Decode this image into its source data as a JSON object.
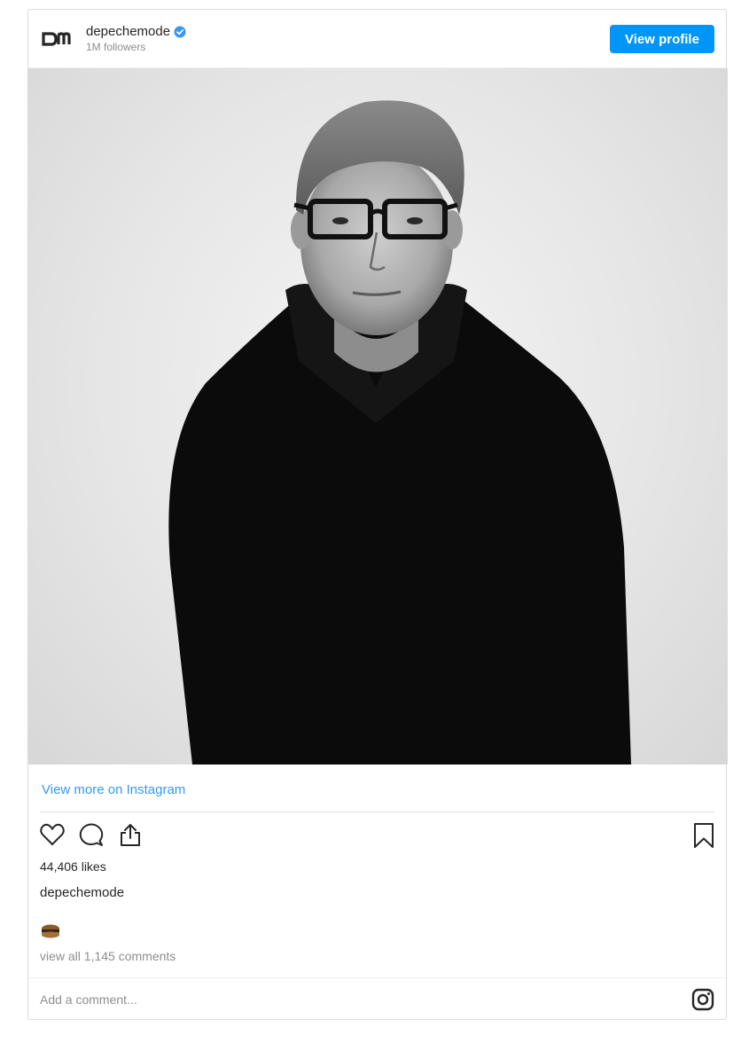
{
  "header": {
    "username": "depechemode",
    "followers": "1M followers",
    "view_profile_label": "View profile"
  },
  "post": {
    "view_more_label": "View more on Instagram",
    "likes": "44,406 likes",
    "caption_user": "depechemode",
    "emoji_name": "sandwich-emoji",
    "comments_link": "view all 1,145 comments",
    "comment_placeholder": "Add a comment..."
  },
  "icons": {
    "verified": "verified-badge-icon",
    "like": "heart-icon",
    "comment": "comment-icon",
    "share": "share-icon",
    "save": "bookmark-icon",
    "instagram": "instagram-icon"
  },
  "colors": {
    "accent": "#0095f6",
    "link": "#3897f0",
    "verified": "#3897f0"
  }
}
